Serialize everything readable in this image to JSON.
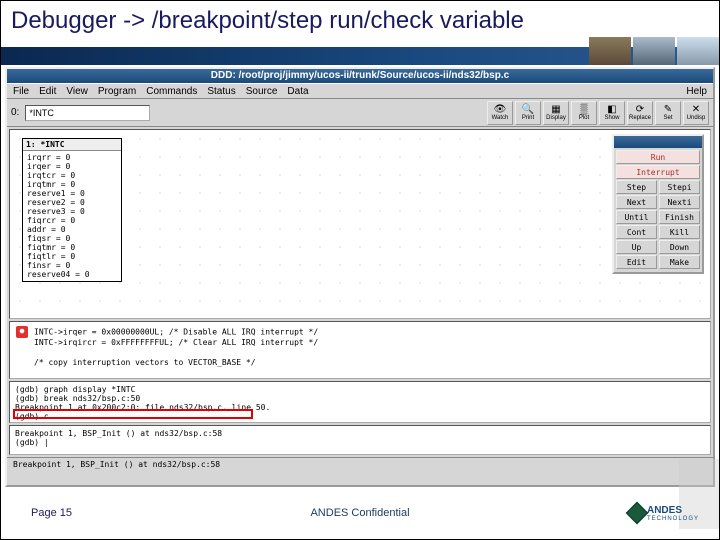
{
  "slide_title": "Debugger -> /breakpoint/step run/check variable",
  "ddd": {
    "window_title": "DDD: /root/proj/jimmy/ucos-ii/trunk/Source/ucos-ii/nds32/bsp.c",
    "menu": [
      "File",
      "Edit",
      "View",
      "Program",
      "Commands",
      "Status",
      "Source",
      "Data"
    ],
    "help": "Help",
    "expr_label": "0:",
    "expr_value": "*INTC",
    "tb_icons": [
      {
        "name": "watch",
        "glyph": "👁",
        "label": "Watch"
      },
      {
        "name": "print",
        "glyph": "🔍",
        "label": "Print"
      },
      {
        "name": "display",
        "glyph": "▦",
        "label": "Display"
      },
      {
        "name": "plot",
        "glyph": "▒",
        "label": "Plot"
      },
      {
        "name": "show",
        "glyph": "◧",
        "label": "Show"
      },
      {
        "name": "replace",
        "glyph": "⟳",
        "label": "Replace"
      },
      {
        "name": "set",
        "glyph": "✎",
        "label": "Set"
      },
      {
        "name": "undisp",
        "glyph": "✕",
        "label": "Undisp"
      }
    ],
    "struct_title": "1: *INTC",
    "struct_fields": [
      "irqrr     = 0",
      "irqer     = 0",
      "irqtcr    = 0",
      "irqtmr    = 0",
      "reserve1  = 0",
      "reserve2  = 0",
      "reserve3  = 0",
      "fiqrcr    = 0",
      "  addr    = 0",
      "fiqsr     = 0",
      "fiqtmr    = 0",
      "fiqtlr    = 0",
      "  finsr   = 0",
      "reserve04 = 0"
    ],
    "ctrl": {
      "run": "Run",
      "interrupt": "Interrupt",
      "rows": [
        [
          "Step",
          "Stepi"
        ],
        [
          "Next",
          "Nexti"
        ],
        [
          "Until",
          "Finish"
        ],
        [
          "Cont",
          "Kill"
        ],
        [
          "Up",
          "Down"
        ],
        [
          "Edit",
          "Make"
        ]
      ]
    },
    "src": [
      "INTC->irqer   = 0x00000000UL; /* Disable ALL IRQ interrupt */",
      "INTC->irqircr = 0xFFFFFFFFUL; /* Clear ALL IRQ interrupt */",
      "",
      "/* copy interruption vectors to VECTOR_BASE */"
    ],
    "gdb1": [
      "(gdb) graph display *INTC",
      "(gdb) break nds32/bsp.c:50",
      "Breakpoint 1 at 0x200c2:0: file nds32/bsp.c, line 50.",
      "(gdb) c"
    ],
    "gdb2": [
      "Breakpoint 1, BSP_Init () at nds32/bsp.c:58",
      "(gdb) |"
    ],
    "status": "Breakpoint 1, BSP_Init () at nds32/bsp.c:58"
  },
  "footer": {
    "page": "Page 15",
    "conf": "ANDES Confidential",
    "logo_top": "ANDES",
    "logo_bottom": "TECHNOLOGY"
  }
}
